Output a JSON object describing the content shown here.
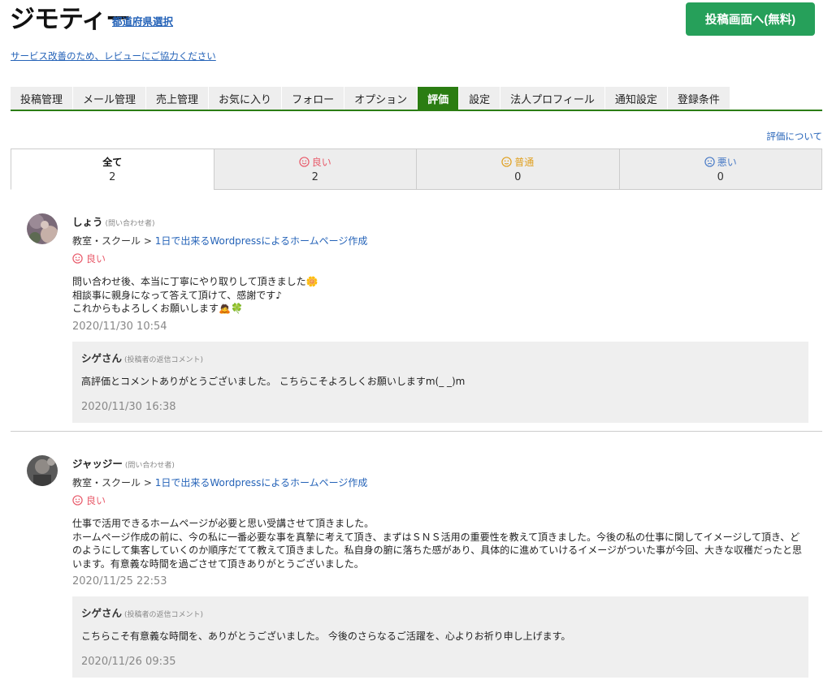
{
  "header": {
    "logo": "ジモティー",
    "prefecture_link": "都道府県選択",
    "post_button": "投稿画面へ(無料)",
    "survey_link": "サービス改善のため、レビューにご協力ください"
  },
  "tabs": [
    {
      "label": "投稿管理"
    },
    {
      "label": "メール管理"
    },
    {
      "label": "売上管理"
    },
    {
      "label": "お気に入り"
    },
    {
      "label": "フォロー"
    },
    {
      "label": "オプション"
    },
    {
      "label": "評価",
      "active": true
    },
    {
      "label": "設定"
    },
    {
      "label": "法人プロフィール"
    },
    {
      "label": "通知設定"
    },
    {
      "label": "登録条件"
    }
  ],
  "about_rating_link": "評価について",
  "filters": [
    {
      "label": "全て",
      "count": "2"
    },
    {
      "label": "良い",
      "count": "2"
    },
    {
      "label": "普通",
      "count": "0"
    },
    {
      "label": "悪い",
      "count": "0"
    }
  ],
  "reviews": [
    {
      "name": "しょう",
      "role": "(問い合わせ者)",
      "category": "教室・スクール",
      "separator": " > ",
      "post_title": "1日で出来るWordpressによるホームページ作成",
      "grade": "良い",
      "text_lines": [
        "問い合わせ後、本当に丁寧にやり取りして頂きました🌼",
        "相談事に親身になって答えて頂けて、感謝です♪",
        "これからもよろしくお願いします🙇🍀"
      ],
      "date": "2020/11/30 10:54",
      "reply": {
        "name": "シゲさん",
        "role": "(投稿者の返信コメント)",
        "text": "高評価とコメントありがとうございました。 こちらこそよろしくお願いしますm(_ _)m",
        "date": "2020/11/30 16:38"
      }
    },
    {
      "name": "ジャッジー",
      "role": "(問い合わせ者)",
      "category": "教室・スクール",
      "separator": " > ",
      "post_title": "1日で出来るWordpressによるホームページ作成",
      "grade": "良い",
      "text_lines": [
        "仕事で活用できるホームページが必要と思い受講させて頂きました。",
        "ホームページ作成の前に、今の私に一番必要な事を真摯に考えて頂き、まずはＳＮＳ活用の重要性を教えて頂きました。今後の私の仕事に関してイメージして頂き、どのようにして集客していくのか順序だてて教えて頂きました。私自身の腑に落ちた感があり、具体的に進めていけるイメージがついた事が今回、大きな収穫だったと思います。有意義な時間を過ごさせて頂きありがとうございました。"
      ],
      "date": "2020/11/25 22:53",
      "reply": {
        "name": "シゲさん",
        "role": "(投稿者の返信コメント)",
        "text": "こちらこそ有意義な時間を、ありがとうございました。 今後のさらなるご活躍を、心よりお祈り申し上げます。",
        "date": "2020/11/26 09:35"
      }
    }
  ],
  "colors": {
    "brand_green": "#26a05a",
    "tab_active": "#2b7d12",
    "good": "#e85a6a",
    "normal": "#e0a020",
    "bad": "#4a7bc6",
    "link": "#2563b8"
  }
}
